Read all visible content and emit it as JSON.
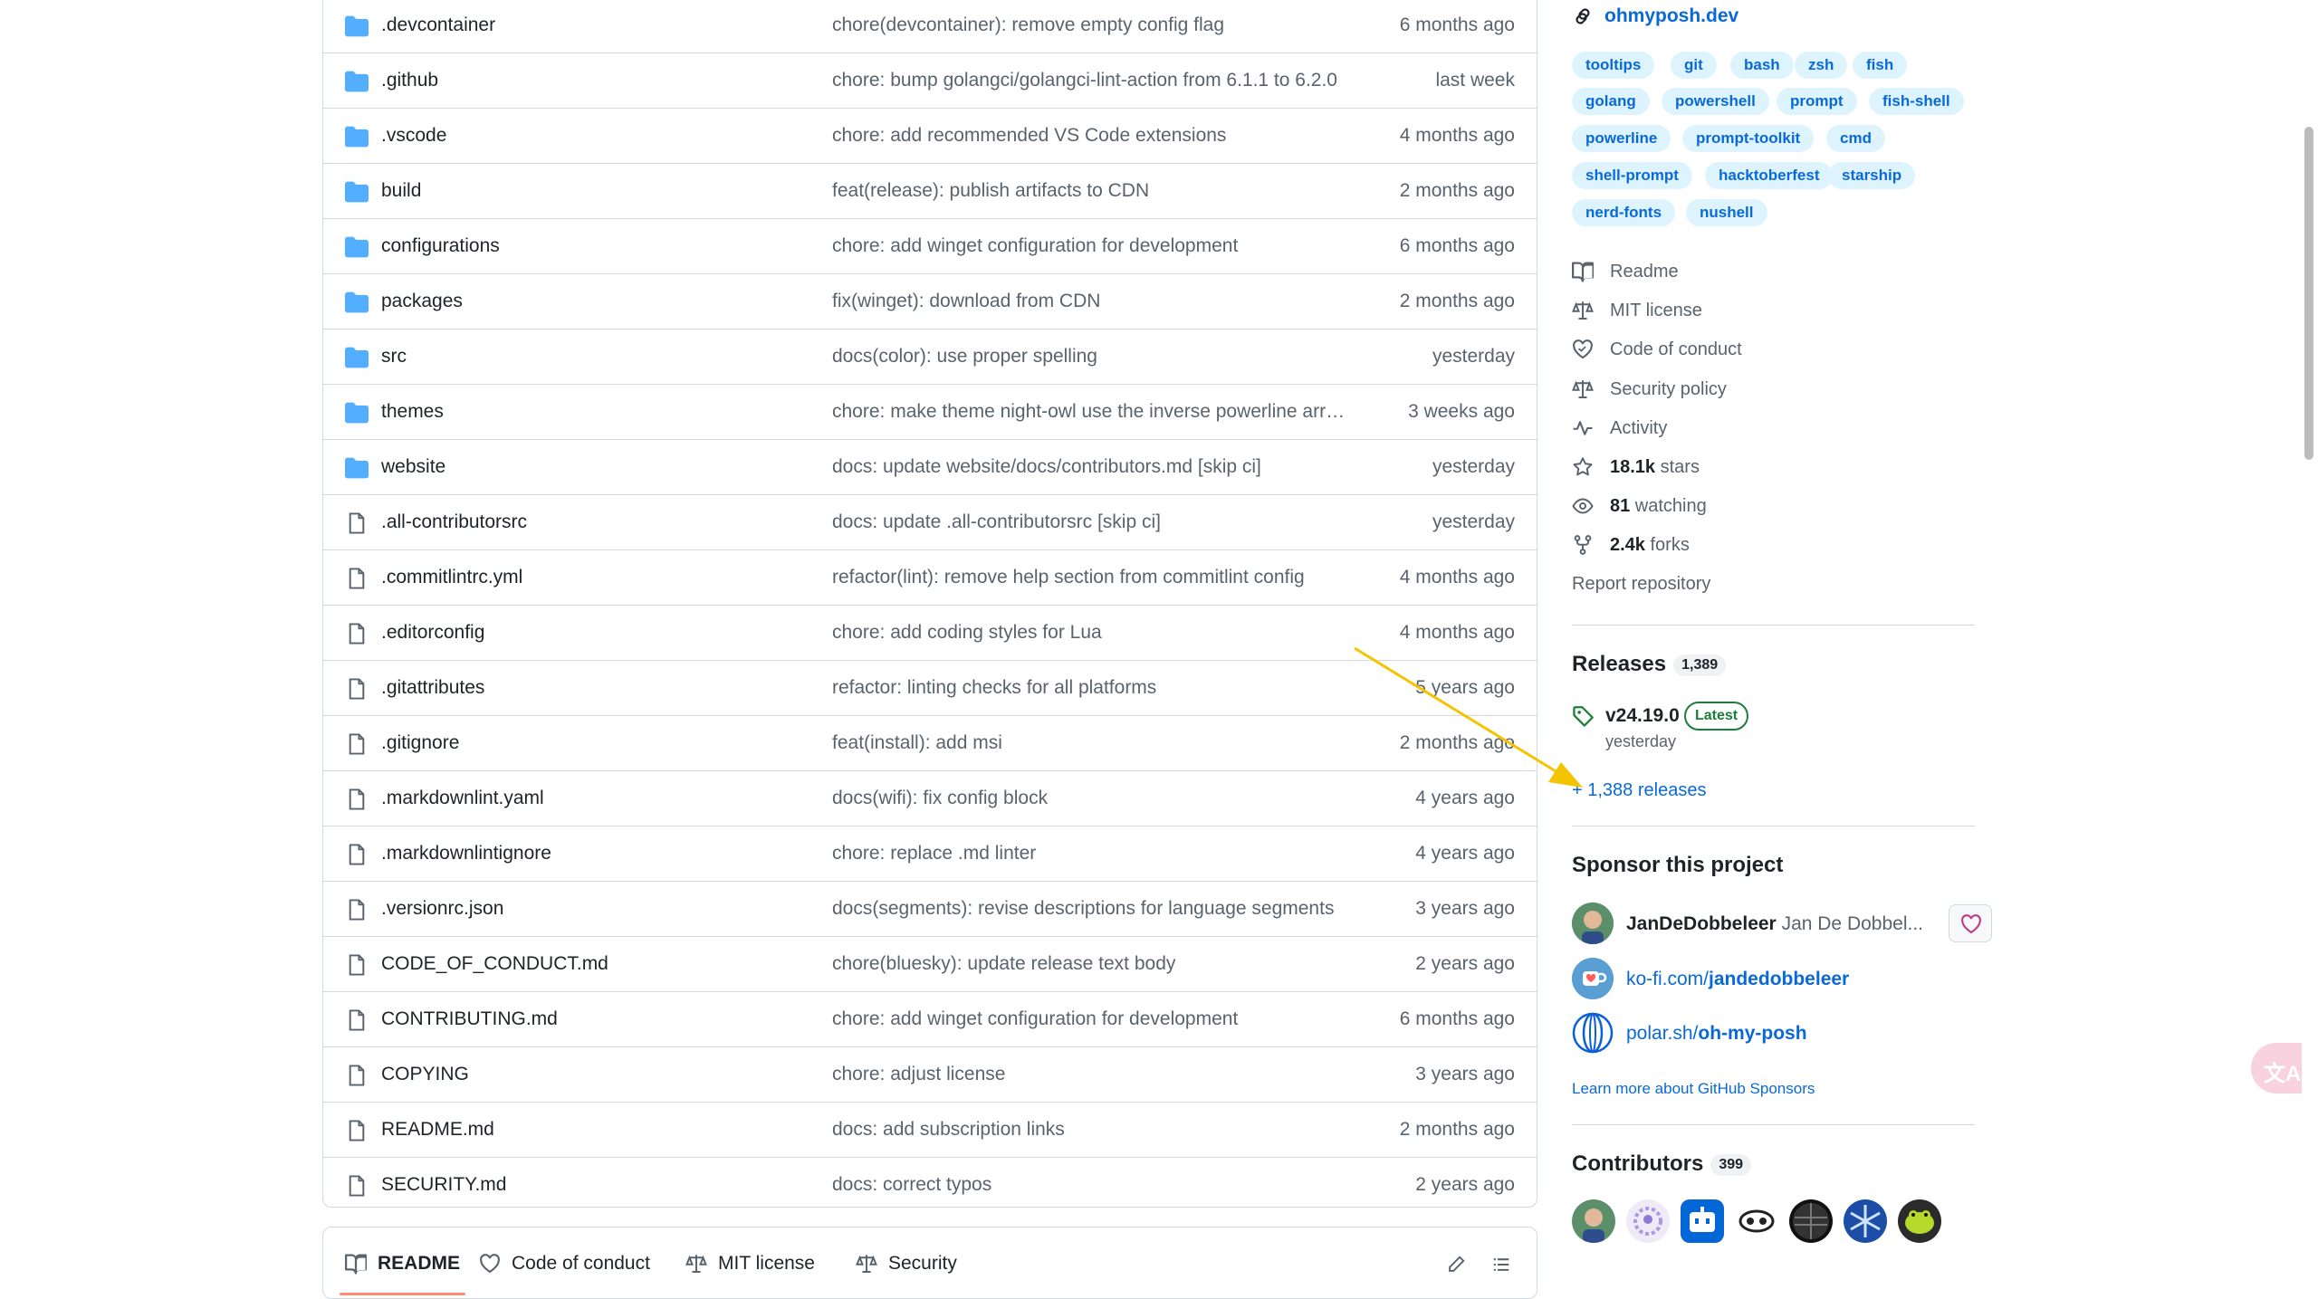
{
  "files": [
    {
      "name": ".devcontainer",
      "type": "folder",
      "message": "chore(devcontainer): remove empty config flag",
      "time": "6 months ago"
    },
    {
      "name": ".github",
      "type": "folder",
      "message": "chore: bump golangci/golangci-lint-action from 6.1.1 to 6.2.0",
      "time": "last week"
    },
    {
      "name": ".vscode",
      "type": "folder",
      "message": "chore: add recommended VS Code extensions",
      "time": "4 months ago"
    },
    {
      "name": "build",
      "type": "folder",
      "message": "feat(release): publish artifacts to CDN",
      "time": "2 months ago"
    },
    {
      "name": "configurations",
      "type": "folder",
      "message": "chore: add winget configuration for development",
      "time": "6 months ago"
    },
    {
      "name": "packages",
      "type": "folder",
      "message": "fix(winget): download from CDN",
      "time": "2 months ago"
    },
    {
      "name": "src",
      "type": "folder",
      "message": "docs(color): use proper spelling",
      "time": "yesterday"
    },
    {
      "name": "themes",
      "type": "folder",
      "message": "chore: make theme night-owl use the inverse powerline arro...",
      "time": "3 weeks ago"
    },
    {
      "name": "website",
      "type": "folder",
      "message": "docs: update website/docs/contributors.md [skip ci]",
      "time": "yesterday"
    },
    {
      "name": ".all-contributorsrc",
      "type": "file",
      "message": "docs: update .all-contributorsrc [skip ci]",
      "time": "yesterday"
    },
    {
      "name": ".commitlintrc.yml",
      "type": "file",
      "message": "refactor(lint): remove help section from commitlint config",
      "time": "4 months ago"
    },
    {
      "name": ".editorconfig",
      "type": "file",
      "message": "chore: add coding styles for Lua",
      "time": "4 months ago"
    },
    {
      "name": ".gitattributes",
      "type": "file",
      "message": "refactor: linting checks for all platforms",
      "time": "5 years ago"
    },
    {
      "name": ".gitignore",
      "type": "file",
      "message": "feat(install): add msi",
      "time": "2 months ago"
    },
    {
      "name": ".markdownlint.yaml",
      "type": "file",
      "message": "docs(wifi): fix config block",
      "time": "4 years ago"
    },
    {
      "name": ".markdownlintignore",
      "type": "file",
      "message": "chore: replace .md linter",
      "time": "4 years ago"
    },
    {
      "name": ".versionrc.json",
      "type": "file",
      "message": "docs(segments): revise descriptions for language segments",
      "time": "3 years ago"
    },
    {
      "name": "CODE_OF_CONDUCT.md",
      "type": "file",
      "message": "chore(bluesky): update release text body",
      "time": "2 years ago"
    },
    {
      "name": "CONTRIBUTING.md",
      "type": "file",
      "message": "chore: add winget configuration for development",
      "time": "6 months ago"
    },
    {
      "name": "COPYING",
      "type": "file",
      "message": "chore: adjust license",
      "time": "3 years ago"
    },
    {
      "name": "README.md",
      "type": "file",
      "message": "docs: add subscription links",
      "time": "2 months ago"
    },
    {
      "name": "SECURITY.md",
      "type": "file",
      "message": "docs: correct typos",
      "time": "2 years ago"
    }
  ],
  "readme_tabs": [
    {
      "label": "README",
      "icon": "book-icon"
    },
    {
      "label": "Code of conduct",
      "icon": "code-of-conduct-icon"
    },
    {
      "label": "MIT license",
      "icon": "law-icon"
    },
    {
      "label": "Security",
      "icon": "law-icon"
    }
  ],
  "sidebar": {
    "website": "ohmyposh.dev",
    "topics": [
      "tooltips",
      "git",
      "bash",
      "zsh",
      "fish",
      "golang",
      "powershell",
      "prompt",
      "fish-shell",
      "powerline",
      "prompt-toolkit",
      "cmd",
      "shell-prompt",
      "hacktoberfest",
      "starship",
      "nerd-fonts",
      "nushell"
    ],
    "about": {
      "readme": "Readme",
      "license": "MIT license",
      "conduct": "Code of conduct",
      "security": "Security policy",
      "activity": "Activity",
      "stars_count": "18.1k",
      "stars_label": " stars",
      "watching_count": "81",
      "watching_label": " watching",
      "forks_count": "2.4k",
      "forks_label": " forks",
      "report": "Report repository"
    },
    "releases": {
      "title": "Releases",
      "count": "1,389",
      "latest_name": "v24.19.0",
      "latest_badge": "Latest",
      "latest_date": "yesterday",
      "more_link": "+ 1,388 releases"
    },
    "sponsor": {
      "title": "Sponsor this project",
      "user_login": "JanDeDobbeleer",
      "user_name": " Jan De Dobbel...",
      "kofi_prefix": "ko-fi.com/",
      "kofi_user": "jandedobbeleer",
      "polar_prefix": "polar.sh/",
      "polar_user": "oh-my-posh",
      "learn_more": "Learn more about GitHub Sponsors"
    },
    "contributors": {
      "title": "Contributors",
      "count": "399"
    }
  },
  "colors": {
    "link": "#0969da",
    "folder": "#54aeff",
    "annotation_arrow": "#f5c400",
    "latest_green": "#1a7f37"
  },
  "translate_icon": "translate-icon"
}
